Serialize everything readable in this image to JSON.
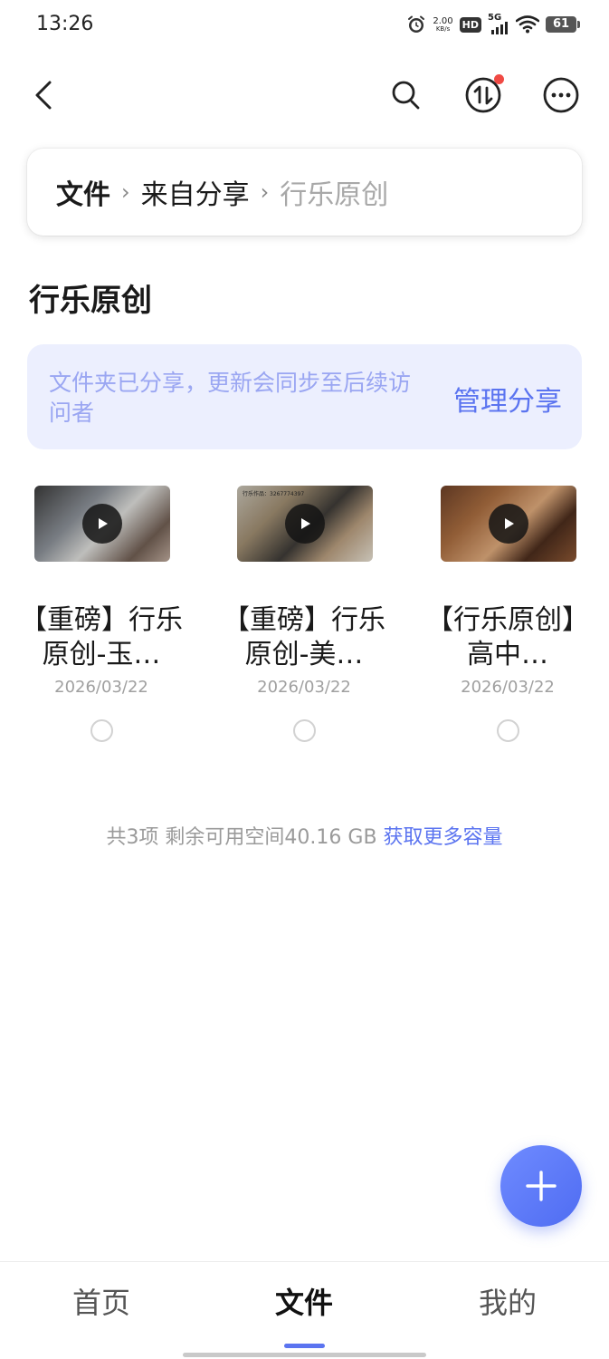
{
  "status_bar": {
    "time": "13:26",
    "net_speed_value": "2.00",
    "net_speed_unit": "KB/s",
    "hd_label": "HD",
    "network_label": "5G",
    "battery": "61"
  },
  "toolbar": {
    "back_icon": "chevron-left-icon",
    "search_icon": "search-icon",
    "transfer_icon": "transfer-icon",
    "more_icon": "more-icon",
    "notification_dot_color": "#f04a44"
  },
  "breadcrumb": {
    "root": "文件",
    "middle": "来自分享",
    "current": "行乐原创"
  },
  "page_title": "行乐原创",
  "share_banner": {
    "note": "文件夹已分享，更新会同步至后续访问者",
    "manage_label": "管理分享"
  },
  "files": [
    {
      "name": "【重磅】行乐原创-玉…",
      "date": "2026/03/22",
      "thumb_caption": ""
    },
    {
      "name": "【重磅】行乐原创-美…",
      "date": "2026/03/22",
      "thumb_caption": "行乐作品：3267774397"
    },
    {
      "name": "【行乐原创】高中…",
      "date": "2026/03/22",
      "thumb_caption": ""
    }
  ],
  "footer": {
    "summary": "共3项 剩余可用空间40.16 GB",
    "link": "获取更多容量"
  },
  "fab_icon": "plus-icon",
  "bottom_nav": {
    "home": "首页",
    "files": "文件",
    "mine": "我的",
    "active": "files"
  },
  "colors": {
    "accent": "#5b74f0",
    "banner_bg": "#eceffe"
  }
}
